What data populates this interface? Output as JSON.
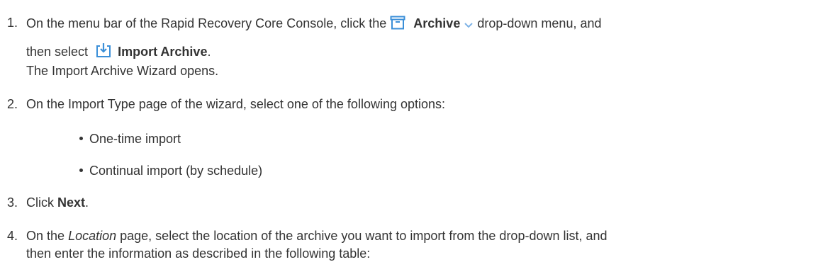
{
  "steps": [
    {
      "number": "1.",
      "line1_before": "On the menu bar of the Rapid Recovery Core Console, click the",
      "archive_label": "Archive",
      "line1_after": "drop-down menu, and",
      "line2_before": "then select",
      "import_label": "Import Archive",
      "line2_after": ".",
      "line3": "The Import Archive Wizard opens.",
      "icons": [
        "archive-box-icon",
        "chevron-down-icon",
        "import-archive-icon"
      ]
    },
    {
      "number": "2.",
      "text": "On the Import Type page of the wizard, select one of the following options:",
      "options": [
        "One-time import",
        "Continual import (by schedule)"
      ]
    },
    {
      "number": "3.",
      "before": "Click",
      "bold": "Next",
      "after": "."
    },
    {
      "number": "4.",
      "before": "On the",
      "italic": "Location",
      "after": "page, select the location of the archive you want to import from the drop-down list, and",
      "line2": "then enter the information as described in the following table:"
    }
  ],
  "colors": {
    "text": "#333333",
    "icon": "#3b8fd8",
    "chevron": "#7fb3e6"
  }
}
